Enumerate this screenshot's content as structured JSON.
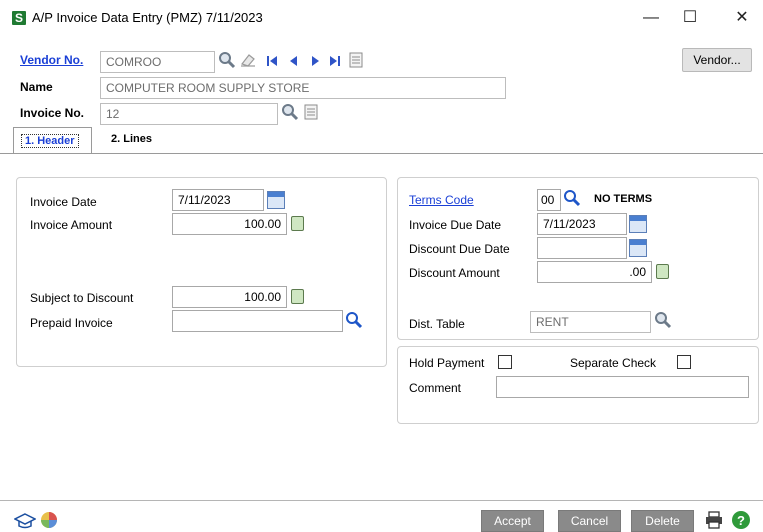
{
  "window": {
    "app_icon_glyph": "S",
    "title": "A/P Invoice Data Entry (PMZ) 7/11/2023",
    "minimize_glyph": "—",
    "maximize_glyph": "☐",
    "close_glyph": "✕"
  },
  "header": {
    "vendor_no_label": "Vendor No.",
    "vendor_no_value": "COMROO",
    "name_label": "Name",
    "name_value": "COMPUTER ROOM SUPPLY STORE",
    "invoice_no_label": "Invoice No.",
    "invoice_no_value": "12",
    "vendor_button": "Vendor..."
  },
  "tabs": [
    {
      "label": "1. Header",
      "active": true
    },
    {
      "label": "2. Lines",
      "active": false
    }
  ],
  "left_panel": {
    "invoice_date_label": "Invoice Date",
    "invoice_date_value": "7/11/2023",
    "invoice_amount_label": "Invoice Amount",
    "invoice_amount_value": "100.00",
    "subject_to_discount_label": "Subject to Discount",
    "subject_to_discount_value": "100.00",
    "prepaid_invoice_label": "Prepaid Invoice",
    "prepaid_invoice_value": ""
  },
  "right_panel": {
    "terms_code_label": "Terms Code",
    "terms_code_value": "00",
    "terms_desc": "NO TERMS",
    "invoice_due_date_label": "Invoice Due Date",
    "invoice_due_date_value": "7/11/2023",
    "discount_due_date_label": "Discount Due Date",
    "discount_due_date_value": "",
    "discount_amount_label": "Discount Amount",
    "discount_amount_value": ".00",
    "dist_table_label": "Dist. Table",
    "dist_table_value": "RENT"
  },
  "payment_panel": {
    "hold_payment_label": "Hold Payment",
    "hold_payment_checked": false,
    "separate_check_label": "Separate Check",
    "separate_check_checked": false,
    "comment_label": "Comment",
    "comment_value": ""
  },
  "footer": {
    "accept_label": "Accept",
    "cancel_label": "Cancel",
    "delete_label": "Delete"
  },
  "colors": {
    "link": "#1a3fd6",
    "button_gray": "#8a8a8a",
    "app_icon_green": "#1f7a32"
  }
}
